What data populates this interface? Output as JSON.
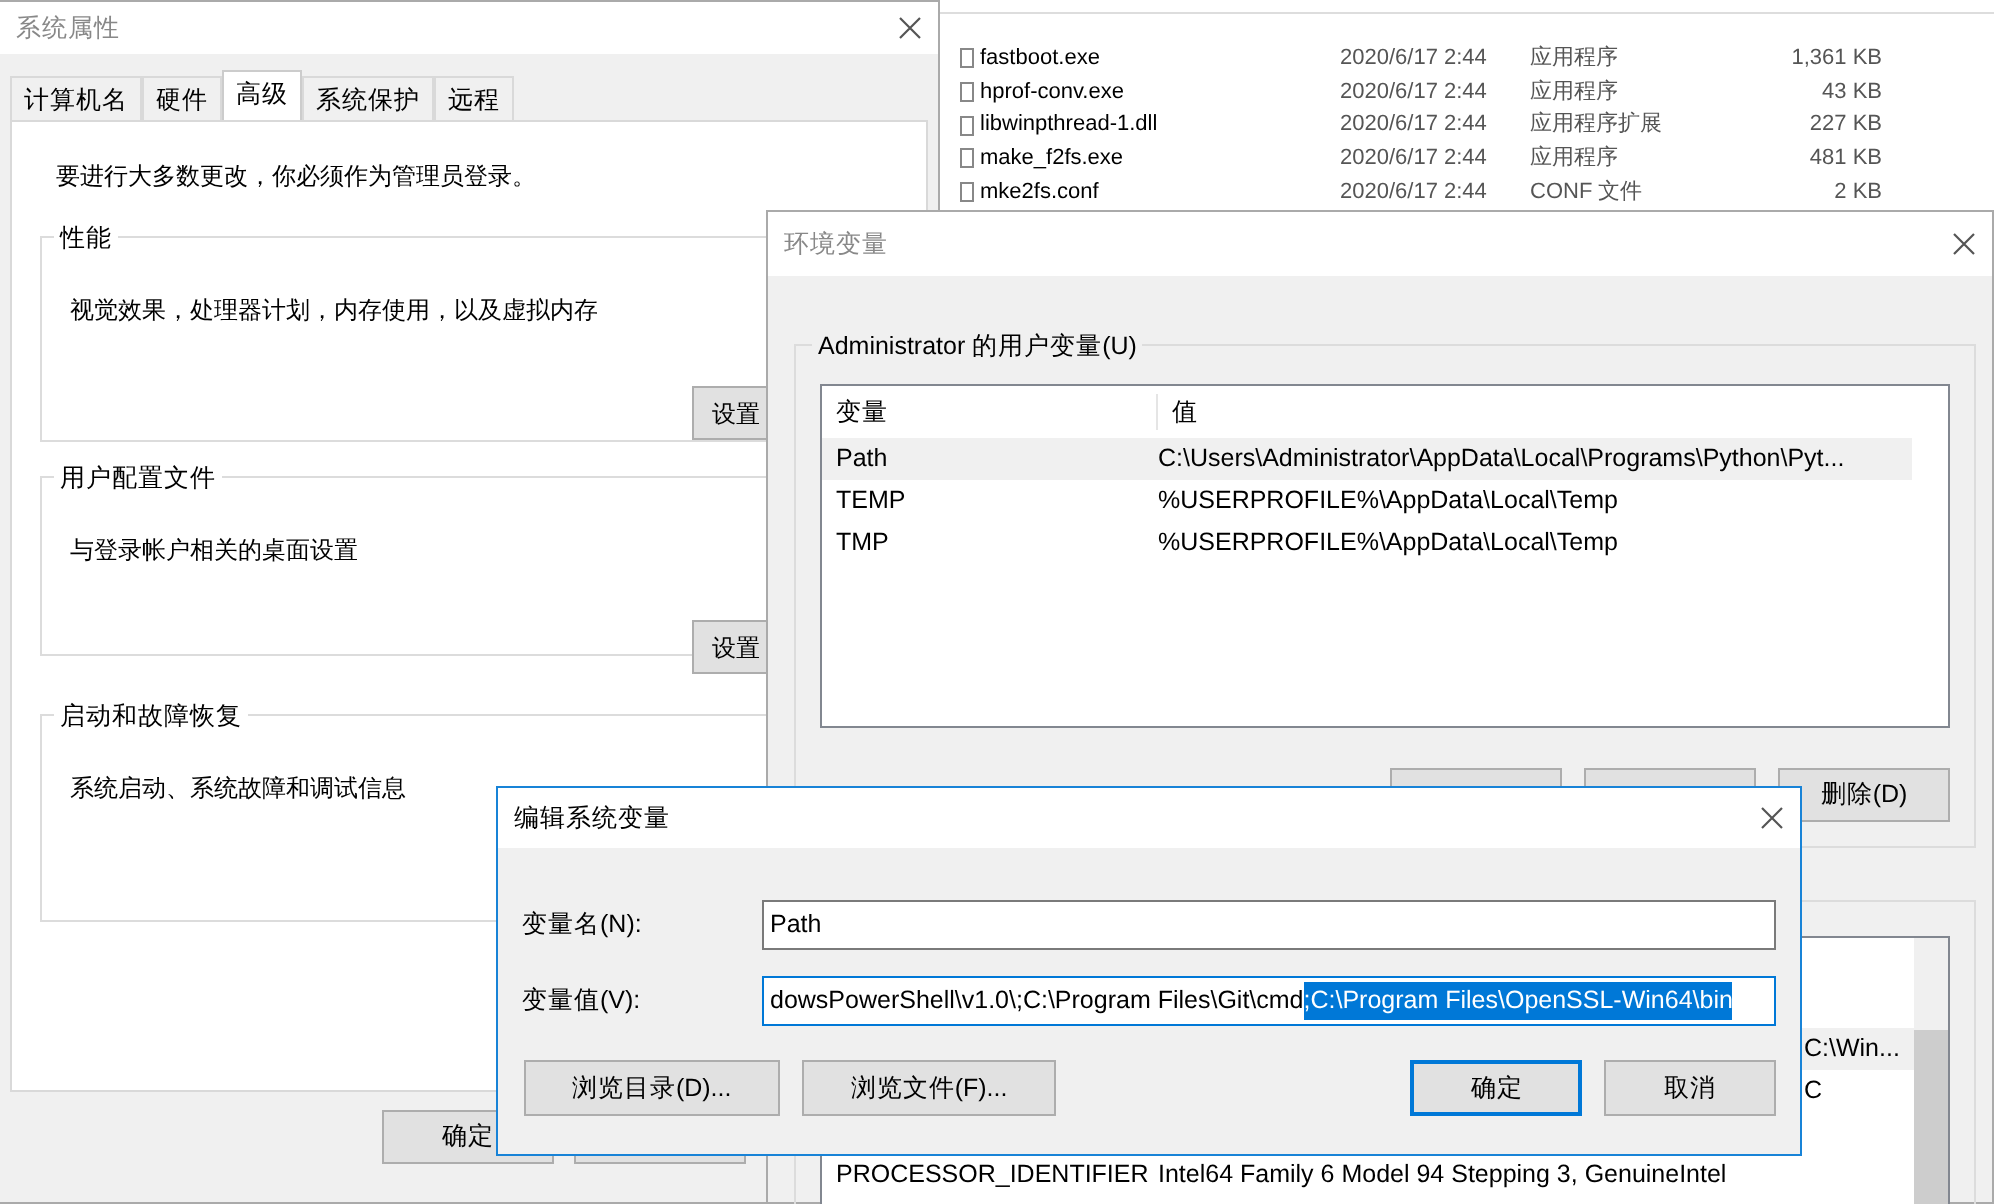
{
  "explorer_files": [
    {
      "name": "fastboot.exe",
      "date": "2020/6/17 2:44",
      "type": "应用程序",
      "size": "1,361 KB"
    },
    {
      "name": "hprof-conv.exe",
      "date": "2020/6/17 2:44",
      "type": "应用程序",
      "size": "43 KB"
    },
    {
      "name": "libwinpthread-1.dll",
      "date": "2020/6/17 2:44",
      "type": "应用程序扩展",
      "size": "227 KB"
    },
    {
      "name": "make_f2fs.exe",
      "date": "2020/6/17 2:44",
      "type": "应用程序",
      "size": "481 KB"
    },
    {
      "name": "mke2fs.conf",
      "date": "2020/6/17 2:44",
      "type": "CONF 文件",
      "size": "2 KB"
    }
  ],
  "system_properties": {
    "title": "系统属性",
    "tabs": [
      {
        "label": "计算机名",
        "selected": false
      },
      {
        "label": "硬件",
        "selected": false
      },
      {
        "label": "高级",
        "selected": true
      },
      {
        "label": "系统保护",
        "selected": false
      },
      {
        "label": "远程",
        "selected": false
      }
    ],
    "notice": "要进行大多数更改，你必须作为管理员登录。",
    "groups": [
      {
        "title": "性能",
        "description": "视觉效果，处理器计划，内存使用，以及虚拟内存",
        "button": "设置"
      },
      {
        "title": "用户配置文件",
        "description": "与登录帐户相关的桌面设置",
        "button": "设置"
      },
      {
        "title": "启动和故障恢复",
        "description": "系统启动、系统故障和调试信息"
      }
    ],
    "buttons": [
      {
        "kind": "labelled",
        "label": "确定"
      },
      {
        "kind": "covered"
      }
    ]
  },
  "environment_variables": {
    "title": "环境变量",
    "user_group": {
      "title": "Administrator 的用户变量(U)",
      "columns": [
        "变量",
        "值"
      ],
      "rows": [
        {
          "name": "Path",
          "value": "C:\\Users\\Administrator\\AppData\\Local\\Programs\\Python\\Pyt...",
          "selected": true
        },
        {
          "name": "TEMP",
          "value": "%USERPROFILE%\\AppData\\Local\\Temp",
          "selected": false
        },
        {
          "name": "TMP",
          "value": "%USERPROFILE%\\AppData\\Local\\Temp",
          "selected": false
        }
      ]
    },
    "user_buttons": [
      {
        "kind": "covered"
      },
      {
        "kind": "covered"
      },
      {
        "kind": "labelled",
        "label": "删除(D)"
      }
    ],
    "system_rows": [
      {
        "kind": "tail",
        "value": "C:\\Win...",
        "selected": true
      },
      {
        "kind": "tail",
        "value": "C",
        "selected": false
      },
      {
        "kind": "full",
        "name": "PROCESSOR_IDENTIFIER",
        "value": "Intel64 Family 6 Model 94 Stepping 3, GenuineIntel",
        "selected": false,
        "gap_before": true
      }
    ]
  },
  "edit_dialog": {
    "title": "编辑系统变量",
    "fields": [
      {
        "label": "变量名(N):",
        "value": "Path",
        "focused": false
      },
      {
        "label": "变量值(V):",
        "value": "dowsPowerShell\\v1.0\\;C:\\Program Files\\Git\\cmd",
        "selected_text": ";C:\\Program Files\\OpenSSL-Win64\\bin",
        "focused": true
      }
    ],
    "buttons": [
      {
        "label": "浏览目录(D)...",
        "default": false
      },
      {
        "label": "浏览文件(F)...",
        "default": false
      },
      {
        "label": "确定",
        "default": true
      },
      {
        "label": "取消",
        "default": false
      }
    ]
  }
}
